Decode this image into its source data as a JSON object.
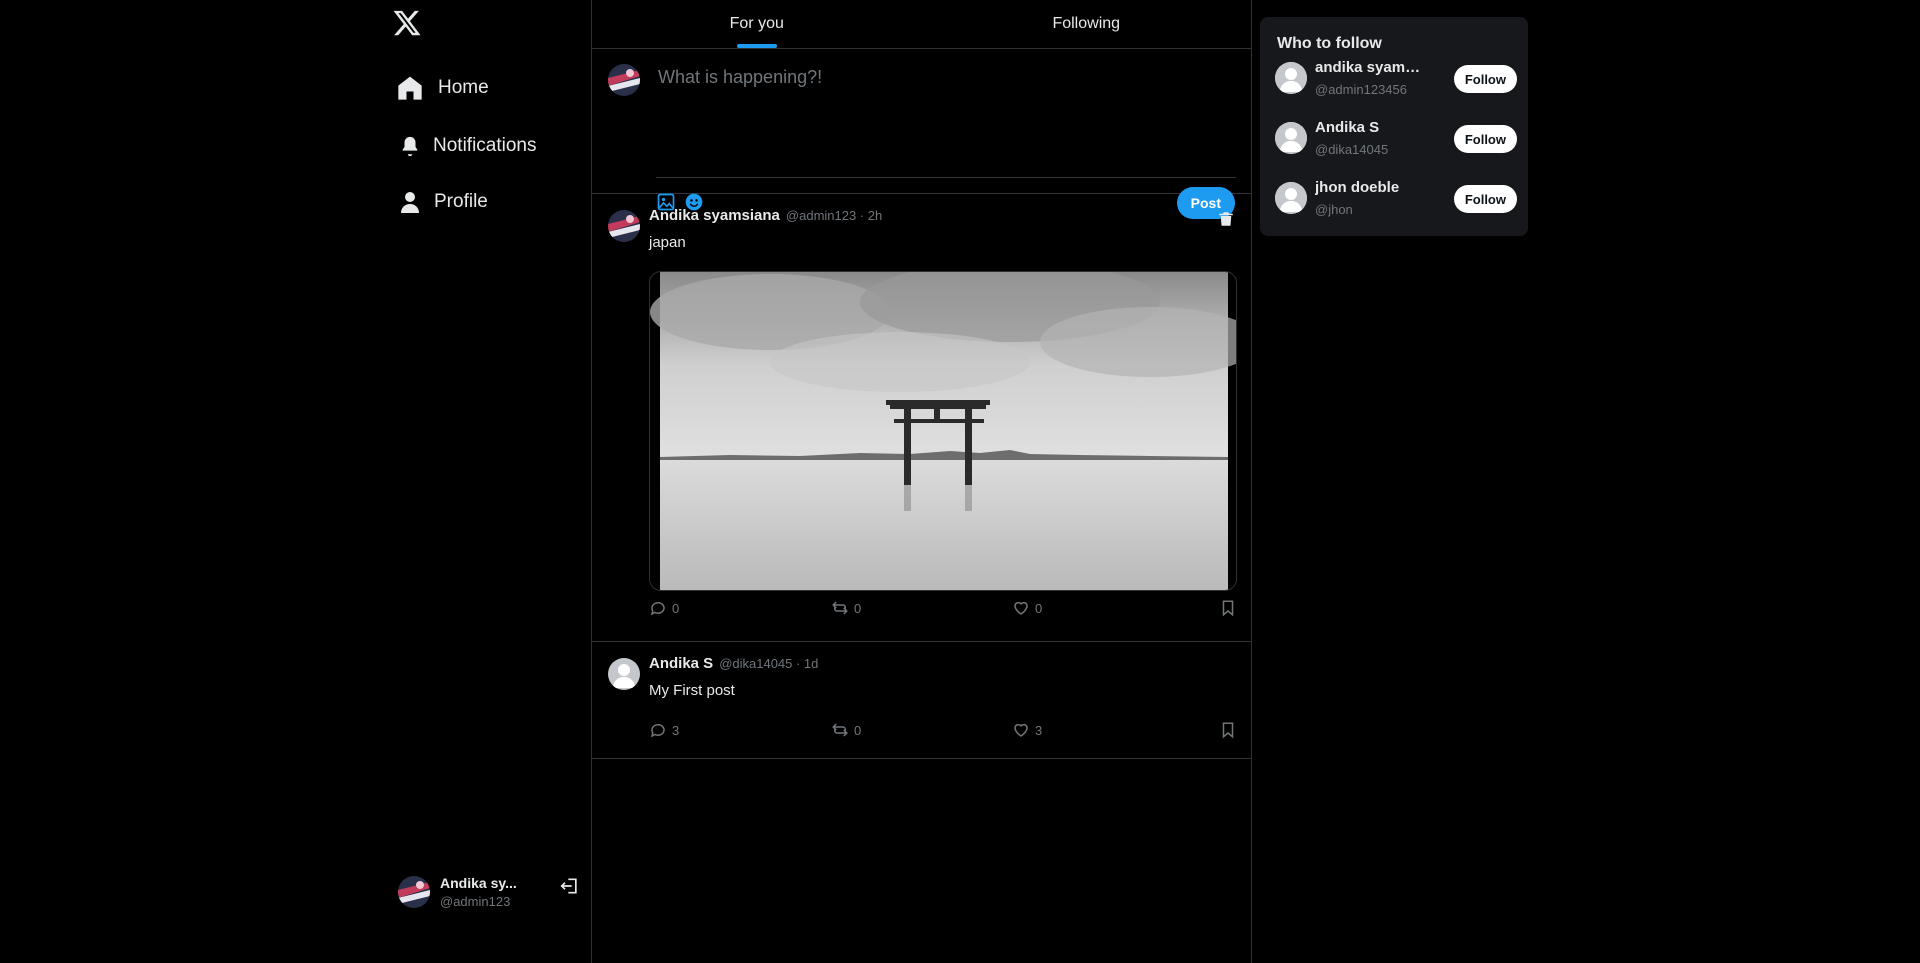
{
  "sidebar": {
    "nav": [
      {
        "label": "Home",
        "icon": "home-icon"
      },
      {
        "label": "Notifications",
        "icon": "bell-icon"
      },
      {
        "label": "Profile",
        "icon": "person-icon"
      }
    ],
    "account": {
      "name": "Andika sy...",
      "handle": "@admin123"
    }
  },
  "main": {
    "tabs": [
      {
        "label": "For you",
        "active": true
      },
      {
        "label": "Following",
        "active": false
      }
    ],
    "composer": {
      "placeholder": "What is happening?!",
      "post_label": "Post"
    },
    "posts": [
      {
        "author": "Andika syamsiana",
        "meta": "@admin123 · 2h",
        "text": "japan",
        "has_image": true,
        "image_subject": "torii gate in lake, black and white",
        "replies": "0",
        "reposts": "0",
        "likes": "0"
      },
      {
        "author": "Andika S",
        "meta": "@dika14045 · 1d",
        "text": "My First post",
        "has_image": false,
        "replies": "3",
        "reposts": "0",
        "likes": "3"
      }
    ]
  },
  "who_to_follow": {
    "title": "Who to follow",
    "users": [
      {
        "name": "andika syamsi...",
        "handle": "@admin123456",
        "button": "Follow"
      },
      {
        "name": "Andika S",
        "handle": "@dika14045",
        "button": "Follow"
      },
      {
        "name": "jhon doeble",
        "handle": "@jhon",
        "button": "Follow"
      }
    ]
  },
  "colors": {
    "accent": "#1d9bf0",
    "background": "#000000",
    "border": "#2f3336",
    "muted_text": "#71767b",
    "card": "#16181c"
  }
}
